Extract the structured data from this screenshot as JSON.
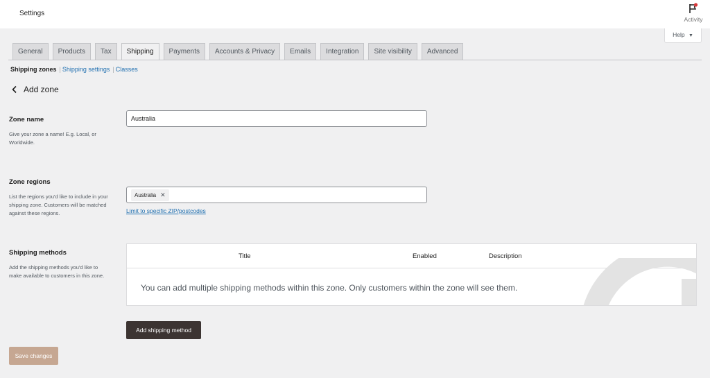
{
  "header": {
    "title": "Settings",
    "activity_label": "Activity"
  },
  "help": {
    "label": "Help",
    "arrow": "▼"
  },
  "tabs": [
    {
      "label": "General"
    },
    {
      "label": "Products"
    },
    {
      "label": "Tax"
    },
    {
      "label": "Shipping",
      "active": true
    },
    {
      "label": "Payments"
    },
    {
      "label": "Accounts & Privacy"
    },
    {
      "label": "Emails"
    },
    {
      "label": "Integration"
    },
    {
      "label": "Site visibility"
    },
    {
      "label": "Advanced"
    }
  ],
  "subnav": {
    "current": "Shipping zones",
    "sep": "|",
    "link1": "Shipping settings",
    "link2": "Classes"
  },
  "page": {
    "back_label": "Add zone"
  },
  "zone_name": {
    "label": "Zone name",
    "description": "Give your zone a name! E.g. Local, or Worldwide.",
    "value": "Australia"
  },
  "zone_regions": {
    "label": "Zone regions",
    "description": "List the regions you'd like to include in your shipping zone. Customers will be matched against these regions.",
    "chip": "Australia",
    "chip_remove": "✕",
    "limit_link": "Limit to specific ZIP/postcodes"
  },
  "shipping_methods": {
    "label": "Shipping methods",
    "description": "Add the shipping methods you'd like to make available to customers in this zone.",
    "columns": {
      "title": "Title",
      "enabled": "Enabled",
      "description": "Description"
    },
    "empty_message": "You can add multiple shipping methods within this zone. Only customers within the zone will see them."
  },
  "buttons": {
    "add_method": "Add shipping method",
    "save": "Save changes"
  },
  "colors": {
    "accent": "#2271b1",
    "dark_button": "#3c3432",
    "save_button": "#c6a792",
    "notification_dot": "#d63638"
  },
  "icons": {
    "activity": "flag-icon",
    "back": "chevron-left-icon",
    "help": "caret-down-icon",
    "chip_remove": "close-icon"
  }
}
